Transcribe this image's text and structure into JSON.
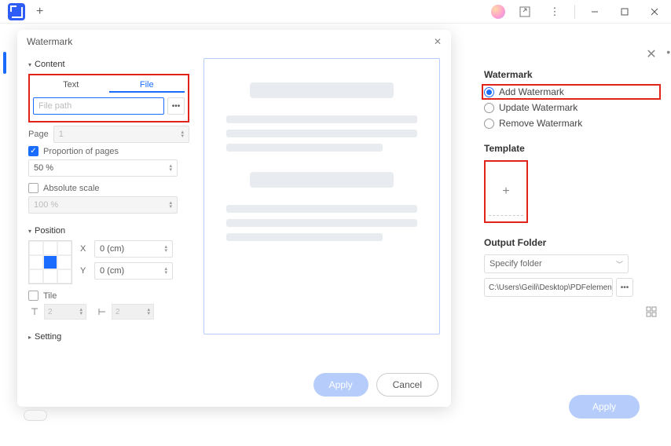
{
  "titlebar": {
    "plus": "+"
  },
  "modal": {
    "title": "Watermark",
    "content_label": "Content",
    "tabs": {
      "text": "Text",
      "file": "File"
    },
    "file_placeholder": "File path",
    "browse": "•••",
    "page_label": "Page",
    "page_value": "1",
    "proportion_label": "Proportion of pages",
    "proportion_value": "50 %",
    "absolute_label": "Absolute scale",
    "absolute_value": "100 %",
    "position_label": "Position",
    "x_label": "X",
    "x_value": "0 (cm)",
    "y_label": "Y",
    "y_value": "0 (cm)",
    "tile_label": "Tile",
    "tile_h": "2",
    "tile_v": "2",
    "setting_label": "Setting",
    "apply": "Apply",
    "cancel": "Cancel"
  },
  "side": {
    "watermark_heading": "Watermark",
    "options": {
      "add": "Add Watermark",
      "update": "Update Watermark",
      "remove": "Remove Watermark"
    },
    "template_heading": "Template",
    "template_plus": "+",
    "output_heading": "Output Folder",
    "specify": "Specify folder",
    "path": "C:\\Users\\Geili\\Desktop\\PDFelement\\W",
    "dots": "•••",
    "apply": "Apply"
  }
}
